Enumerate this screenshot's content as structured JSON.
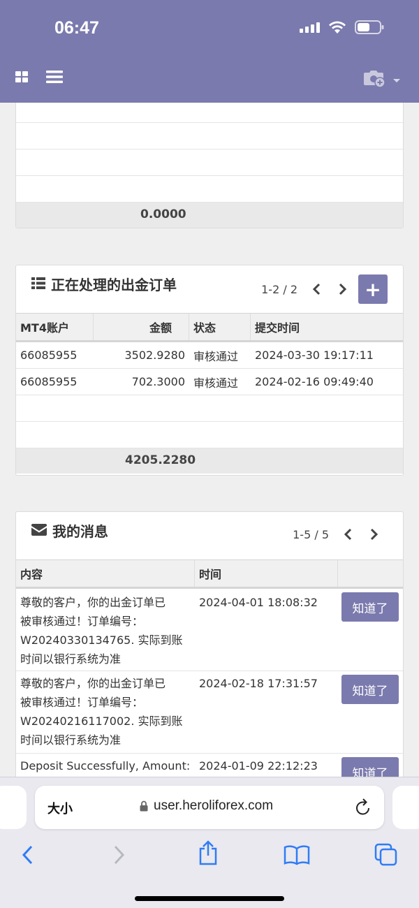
{
  "status_bar": {
    "time": "06:47"
  },
  "colors": {
    "header": "#7b7aae",
    "accent": "#7b7aae"
  },
  "header": {
    "left_icons": [
      "grid-icon",
      "menu-icon"
    ],
    "right_icons": [
      "camera-add-icon",
      "caret-down-icon"
    ]
  },
  "top_panel": {
    "total": "0.0000"
  },
  "withdraw_panel": {
    "title": "正在处理的出金订单",
    "pager": "1-2 / 2",
    "add_label": "+",
    "columns": [
      "MT4账户",
      "金额",
      "状态",
      "提交时间"
    ],
    "rows": [
      {
        "account": "66085955",
        "amount": "3502.9280",
        "status": "审核通过",
        "time": "2024-03-30 19:17:11"
      },
      {
        "account": "66085955",
        "amount": "702.3000",
        "status": "审核通过",
        "time": "2024-02-16 09:49:40"
      }
    ],
    "total": "4205.2280"
  },
  "messages_panel": {
    "title": "我的消息",
    "pager": "1-5 / 5",
    "columns": [
      "内容",
      "时间",
      ""
    ],
    "ack_label": "知道了",
    "rows": [
      {
        "lines": [
          "尊敬的客户，你的出金订单已",
          "被审核通过！订单编号：",
          "W20240330134765. 实际到账",
          "时间以银行系统为准"
        ],
        "time": "2024-04-01 18:08:32"
      },
      {
        "lines": [
          "尊敬的客户，你的出金订单已",
          "被审核通过！订单编号：",
          "W20240216117002. 实际到账",
          "时间以银行系统为准"
        ],
        "time": "2024-02-18 17:31:57"
      },
      {
        "lines": [
          "Deposit Successfully, Amount:"
        ],
        "time": "2024-01-09 22:12:23"
      }
    ]
  },
  "browser": {
    "text_size_label": "大小",
    "url": "user.heroliforex.com"
  }
}
